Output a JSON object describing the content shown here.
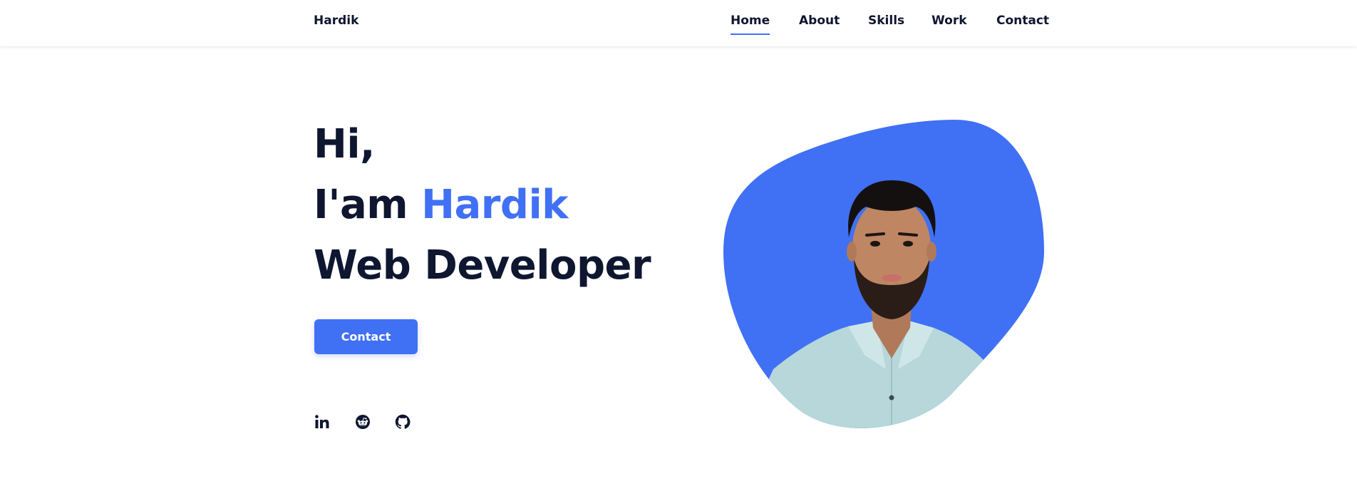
{
  "header": {
    "logo": "Hardik",
    "nav": [
      {
        "label": "Home",
        "active": true
      },
      {
        "label": "About",
        "active": false
      },
      {
        "label": "Skills",
        "active": false
      },
      {
        "label": "Work",
        "active": false
      },
      {
        "label": "Contact",
        "active": false
      }
    ]
  },
  "hero": {
    "greeting": "Hi,",
    "intro_prefix": "I'am ",
    "name": "Hardik",
    "role": "Web Developer",
    "cta_label": "Contact",
    "socials": [
      {
        "icon": "linkedin-icon"
      },
      {
        "icon": "reddit-icon"
      },
      {
        "icon": "github-icon"
      }
    ],
    "image": {
      "description_icon": "profile-photo"
    }
  },
  "colors": {
    "accent": "#4070f4",
    "text": "#0e1630",
    "background": "#ffffff"
  }
}
